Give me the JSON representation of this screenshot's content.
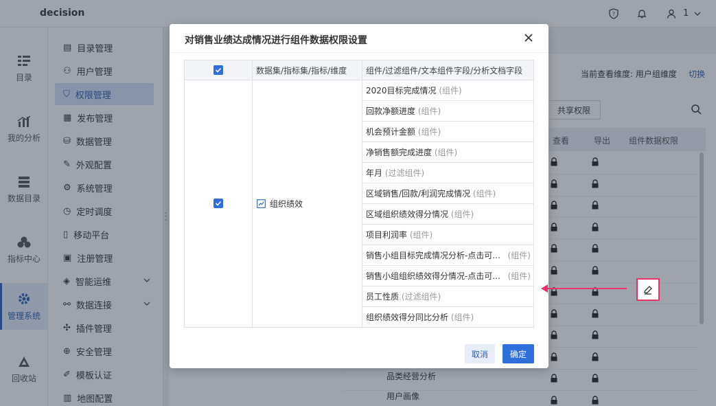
{
  "app": {
    "brand": "decision",
    "user_num": "1"
  },
  "rail": [
    {
      "label": "目录",
      "icon": "catalog-icon"
    },
    {
      "label": "我的分析",
      "icon": "analysis-icon"
    },
    {
      "label": "数据目录",
      "icon": "data-catalog-icon"
    },
    {
      "label": "指标中心",
      "icon": "metric-center-icon"
    },
    {
      "label": "管理系统",
      "icon": "gear-icon",
      "active": true
    },
    {
      "label": "回收站",
      "icon": "recycle-icon"
    }
  ],
  "menu": [
    {
      "label": "目录管理"
    },
    {
      "label": "用户管理"
    },
    {
      "label": "权限管理",
      "active": true
    },
    {
      "label": "发布管理"
    },
    {
      "label": "数据管理"
    },
    {
      "label": "外观配置"
    },
    {
      "label": "系统管理"
    },
    {
      "label": "定时调度"
    },
    {
      "label": "移动平台"
    },
    {
      "label": "注册管理"
    },
    {
      "label": "智能运维",
      "expandable": true
    },
    {
      "label": "数据连接",
      "expandable": true
    },
    {
      "label": "插件管理"
    },
    {
      "label": "安全管理"
    },
    {
      "label": "模板认证"
    },
    {
      "label": "地图配置"
    }
  ],
  "main": {
    "dimension_label": "当前查看维度: 用户组维度",
    "switch_label": "切换",
    "share_button": "共享权限",
    "columns": [
      "查看",
      "导出",
      "组件数据权限"
    ],
    "tree_rows": [
      "品类经营分析",
      "用户画像"
    ]
  },
  "dialog": {
    "title": "对销售业绩达成情况进行组件数据权限设置",
    "headers": {
      "dataset": "数据集/指标集/指标/维度",
      "component": "组件/过滤组件/文本组件字段/分析文档字段"
    },
    "dataset_name": "组织绩效",
    "rows": [
      {
        "name": "2020目标完成情况",
        "tag": "(组件)"
      },
      {
        "name": "回款净额进度",
        "tag": "(组件)"
      },
      {
        "name": "机会预计金额",
        "tag": "(组件)"
      },
      {
        "name": "净销售额完成进度",
        "tag": "(组件)"
      },
      {
        "name": "年月",
        "tag": "(过滤组件)"
      },
      {
        "name": "区域销售/回款/利润完成情况",
        "tag": "(组件)"
      },
      {
        "name": "区域组织绩效得分情况",
        "tag": "(组件)"
      },
      {
        "name": "项目利润率",
        "tag": "(组件)"
      },
      {
        "name": "销售小组目标完成情况分析-点击可...",
        "tag": "(组件)"
      },
      {
        "name": "销售小组组织绩效得分情况-点击可...",
        "tag": "(组件)"
      },
      {
        "name": "员工性质",
        "tag": "(过滤组件)"
      },
      {
        "name": "组织绩效得分同比分析",
        "tag": "(组件)"
      }
    ],
    "cancel_label": "取消",
    "ok_label": "确定"
  },
  "colors": {
    "accent": "#2f6fdb",
    "annotation": "#e8336a"
  }
}
